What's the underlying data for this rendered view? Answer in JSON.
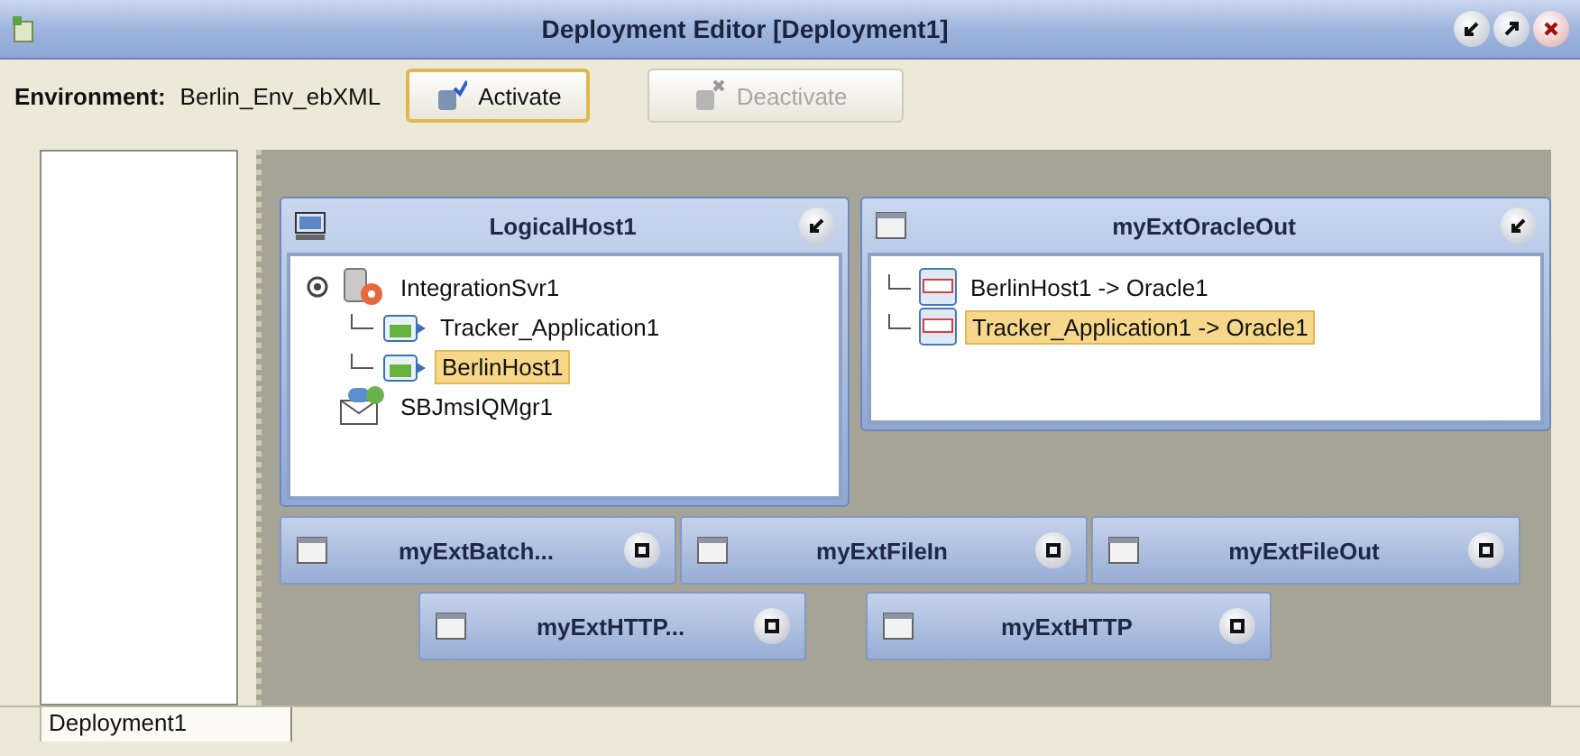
{
  "window": {
    "title": "Deployment Editor [Deployment1]"
  },
  "toolbar": {
    "environment_label": "Environment:",
    "environment_value": "Berlin_Env_ebXML",
    "buttons": [
      {
        "label": "Activate",
        "kind": "activate",
        "disabled": false,
        "hovered": true
      },
      {
        "label": "Deactivate",
        "kind": "deactivate",
        "disabled": true,
        "hovered": false
      }
    ]
  },
  "canvas": {
    "cards": [
      {
        "title": "LogicalHost1",
        "kind": "host",
        "tree": [
          {
            "label": "IntegrationSvr1",
            "kind": "server",
            "expanded": true,
            "selected": false,
            "children": [
              {
                "label": "Tracker_Application1",
                "kind": "app",
                "selected": false
              },
              {
                "label": "BerlinHost1",
                "kind": "app",
                "selected": true
              }
            ]
          },
          {
            "label": "SBJmsIQMgr1",
            "kind": "queue",
            "expanded": false,
            "selected": false
          }
        ]
      },
      {
        "title": "myExtOracleOut",
        "kind": "external",
        "tree": [
          {
            "label": "BerlinHost1 -> Oracle1",
            "kind": "oracle",
            "selected": false
          },
          {
            "label": "Tracker_Application1 -> Oracle1",
            "kind": "oracle",
            "selected": true
          }
        ]
      }
    ],
    "minimized_cards": [
      {
        "title": "myExtBatch..."
      },
      {
        "title": "myExtFileIn"
      },
      {
        "title": "myExtFileOut"
      },
      {
        "title": "myExtHTTP..."
      },
      {
        "title": "myExtHTTP"
      }
    ]
  },
  "bottom_tabs": [
    {
      "label": "Deployment1",
      "selected": true
    }
  ]
}
